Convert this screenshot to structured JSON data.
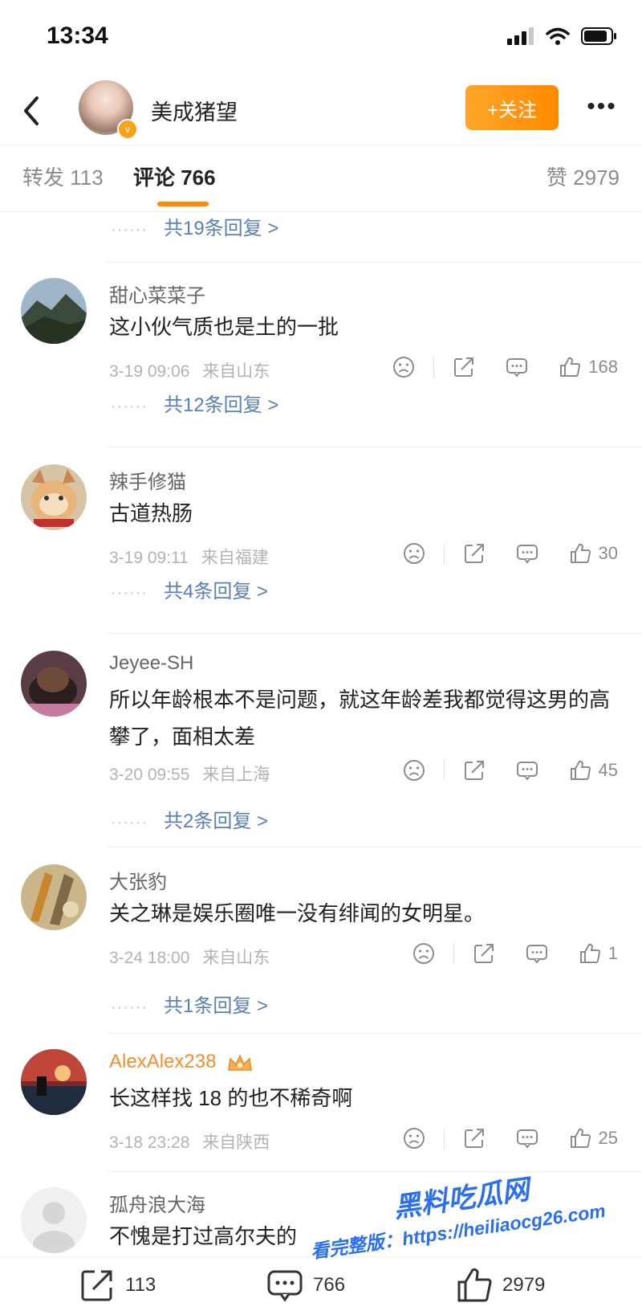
{
  "status": {
    "time": "13:34"
  },
  "header": {
    "username": "美成猪望",
    "follow_label": "+关注",
    "more_label": "•••"
  },
  "tabs": [
    {
      "label": "转发 113"
    },
    {
      "label": "评论 766"
    },
    {
      "label": "赞 2979"
    }
  ],
  "top_reply_link": "共19条回复 >",
  "comments": [
    {
      "name": "甜心菜菜子",
      "text": "这小伙气质也是土的一批",
      "time": "3-19 09:06",
      "location": "来自山东",
      "likes": "168",
      "replies": "共12条回复 >"
    },
    {
      "name": "辣手修猫",
      "text": "古道热肠",
      "time": "3-19 09:11",
      "location": "来自福建",
      "likes": "30",
      "replies": "共4条回复 >"
    },
    {
      "name": "Jeyee-SH",
      "text": "所以年龄根本不是问题，就这年龄差我都觉得这男的高攀了，面相太差",
      "time": "3-20 09:55",
      "location": "来自上海",
      "likes": "45",
      "replies": "共2条回复 >"
    },
    {
      "name": "大张豹",
      "text": "关之琳是娱乐圈唯一没有绯闻的女明星。",
      "time": "3-24 18:00",
      "location": "来自山东",
      "likes": "1",
      "replies": "共1条回复 >"
    },
    {
      "name": "AlexAlex238",
      "text": "长这样找 18 的也不稀奇啊",
      "time": "3-18 23:28",
      "location": "来自陕西",
      "likes": "25"
    },
    {
      "name": "孤舟浪大海",
      "text": "不愧是打过高尔夫的"
    }
  ],
  "bottom_bar": {
    "repost_count": "113",
    "comment_count": "766",
    "like_count": "2979"
  },
  "watermark": {
    "line1": "黑料吃瓜网",
    "line2": "看完整版：https://heiliaocg26.com"
  },
  "colors": {
    "accent": "#ff8a00",
    "link": "#5a7fb5",
    "vip_name": "#f08f2e",
    "watermark": "#2a6ff0"
  },
  "icons": [
    "back-arrow-icon",
    "verified-icon",
    "more-icon",
    "dots-icon",
    "dislike-face-icon",
    "share-icon",
    "comment-icon",
    "thumb-up-icon",
    "crown-icon"
  ]
}
